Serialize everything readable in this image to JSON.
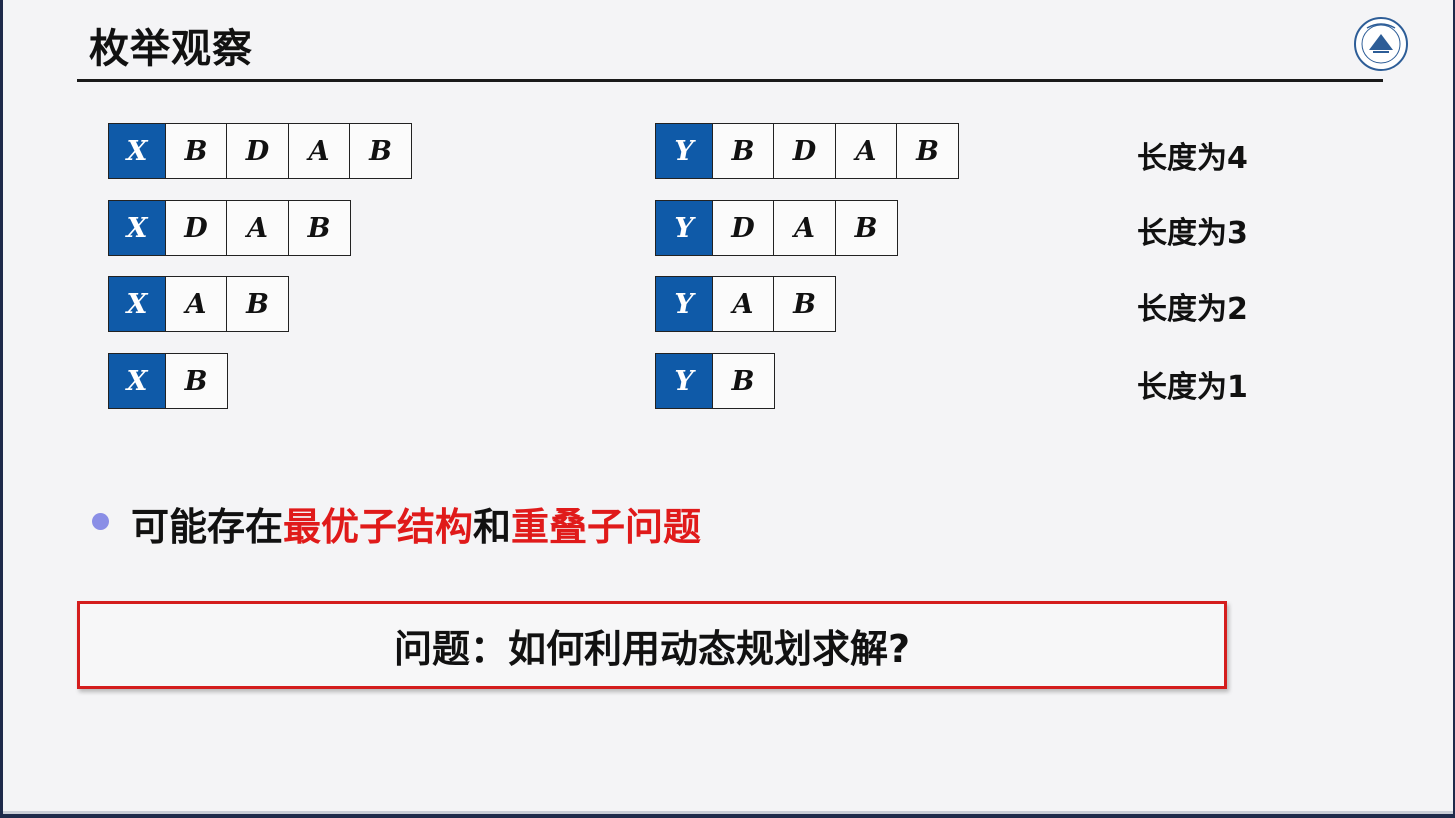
{
  "title": "枚举观察",
  "rows_x": [
    {
      "head": "X",
      "cells": [
        "B",
        "D",
        "A",
        "B"
      ]
    },
    {
      "head": "X",
      "cells": [
        "D",
        "A",
        "B"
      ]
    },
    {
      "head": "X",
      "cells": [
        "A",
        "B"
      ]
    },
    {
      "head": "X",
      "cells": [
        "B"
      ]
    }
  ],
  "rows_y": [
    {
      "head": "Y",
      "cells": [
        "B",
        "D",
        "A",
        "B"
      ]
    },
    {
      "head": "Y",
      "cells": [
        "D",
        "A",
        "B"
      ]
    },
    {
      "head": "Y",
      "cells": [
        "A",
        "B"
      ]
    },
    {
      "head": "Y",
      "cells": [
        "B"
      ]
    }
  ],
  "length_labels": [
    "长度为4",
    "长度为3",
    "长度为2",
    "长度为1"
  ],
  "bullet": {
    "prefix": "可能存在",
    "highlight1": "最优子结构",
    "middle": "和",
    "highlight2": "重叠子问题"
  },
  "question": "问题：如何利用动态规划求解?",
  "colors": {
    "cell_head": "#0f5aa8",
    "highlight": "#e01a1a",
    "box_border": "#d41d1d",
    "bullet": "#8a8ee6"
  }
}
